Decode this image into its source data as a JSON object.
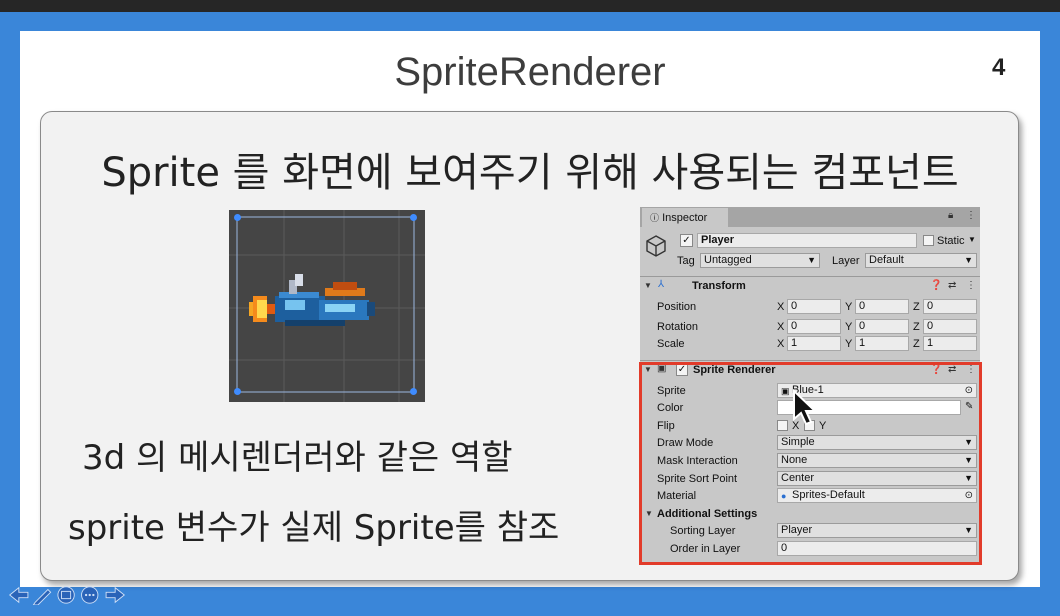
{
  "slide": {
    "title": "SpriteRenderer",
    "page_number": "4",
    "headline": "Sprite 를 화면에 보여주기 위해 사용되는 컴포넌트",
    "line1": "3d 의 메시렌더러와 같은 역할",
    "line2": "sprite 변수가 실제 Sprite를 참조"
  },
  "inspector": {
    "tab_label": "Inspector",
    "object_name": "Player",
    "static_label": "Static",
    "tag_label": "Tag",
    "tag_value": "Untagged",
    "layer_label": "Layer",
    "layer_value": "Default",
    "transform": {
      "title": "Transform",
      "position_label": "Position",
      "rotation_label": "Rotation",
      "scale_label": "Scale",
      "x_label": "X",
      "y_label": "Y",
      "z_label": "Z",
      "position": [
        "0",
        "0",
        "0"
      ],
      "rotation": [
        "0",
        "0",
        "0"
      ],
      "scale": [
        "1",
        "1",
        "1"
      ]
    },
    "sprite_renderer": {
      "title": "Sprite Renderer",
      "sprite_label": "Sprite",
      "sprite_value": "Blue-1",
      "color_label": "Color",
      "flip_label": "Flip",
      "flip_x": "X",
      "flip_y": "Y",
      "draw_mode_label": "Draw Mode",
      "draw_mode_value": "Simple",
      "mask_interaction_label": "Mask Interaction",
      "mask_interaction_value": "None",
      "sort_point_label": "Sprite Sort Point",
      "sort_point_value": "Center",
      "material_label": "Material",
      "material_value": "Sprites-Default",
      "additional_settings_label": "Additional Settings",
      "sorting_layer_label": "Sorting Layer",
      "sorting_layer_value": "Player",
      "order_in_layer_label": "Order in Layer",
      "order_in_layer_value": "0"
    }
  },
  "colors": {
    "frame": "#3a86d9",
    "highlight_border": "#e23b2a",
    "scene_bg": "#454545"
  }
}
